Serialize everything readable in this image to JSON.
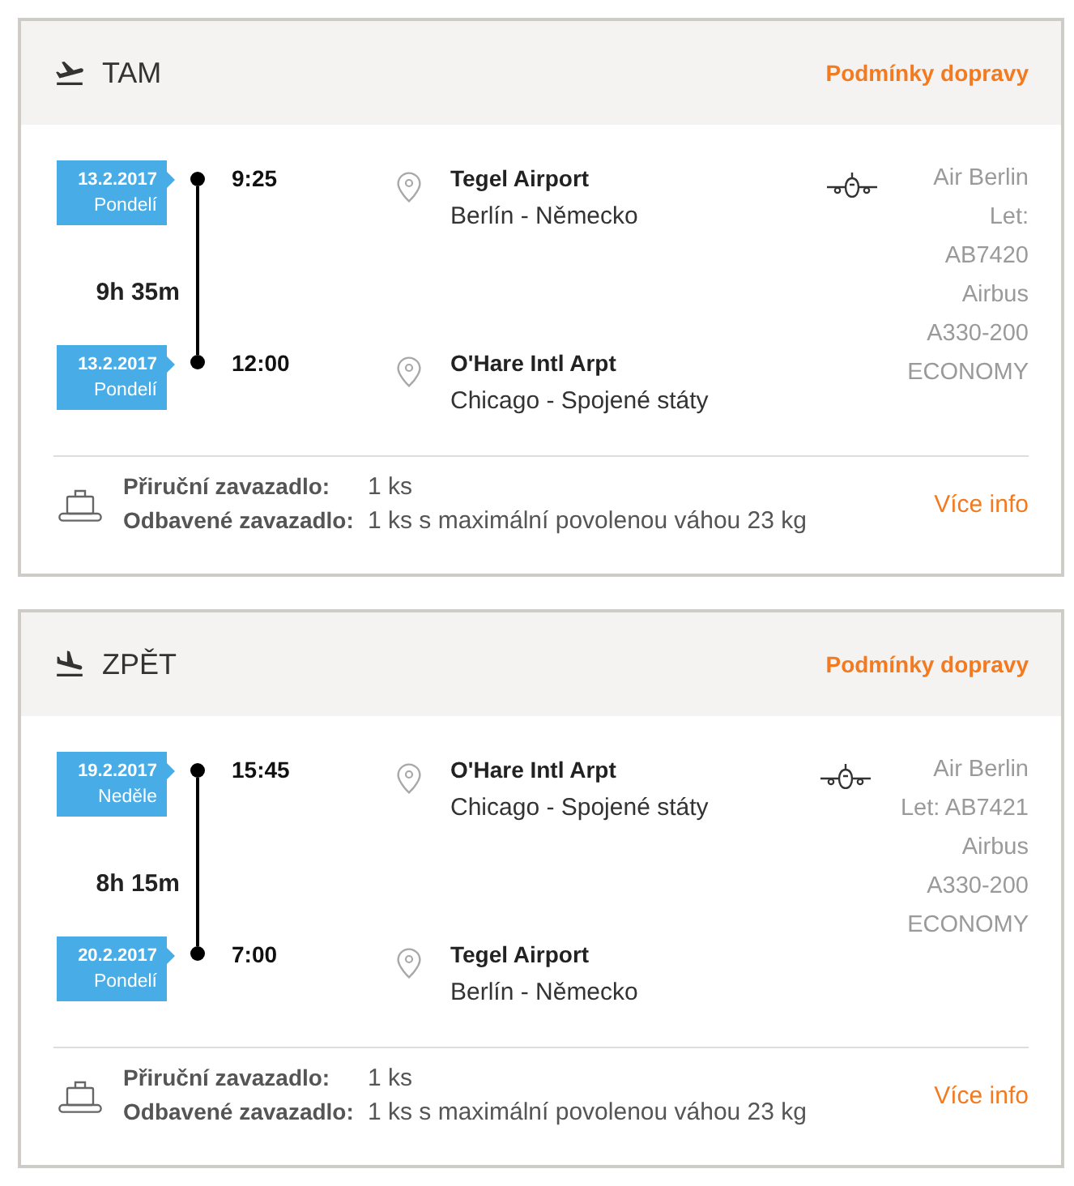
{
  "segments": [
    {
      "kind": "departure",
      "title": "TAM",
      "conditions_link": "Podmínky dopravy",
      "stops": [
        {
          "date": "13.2.2017",
          "day": "Pondelí",
          "time": "9:25",
          "airport": "Tegel Airport",
          "city": "Berlín - Německo"
        },
        {
          "date": "13.2.2017",
          "day": "Pondelí",
          "time": "12:00",
          "airport": "O'Hare Intl Arpt",
          "city": "Chicago - Spojené státy"
        }
      ],
      "duration": "9h 35m",
      "flight_info": [
        "Air Berlin",
        "Let:",
        "AB7420",
        "Airbus",
        "A330-200",
        "ECONOMY"
      ],
      "baggage": [
        {
          "label": "Přiruční zavazadlo:",
          "value": "1 ks"
        },
        {
          "label": "Odbavené zavazadlo:",
          "value": "1 ks s maximální povolenou váhou 23 kg"
        }
      ],
      "more_info": "Více info"
    },
    {
      "kind": "return",
      "title": "ZPĚT",
      "conditions_link": "Podmínky dopravy",
      "stops": [
        {
          "date": "19.2.2017",
          "day": "Neděle",
          "time": "15:45",
          "airport": "O'Hare Intl Arpt",
          "city": "Chicago - Spojené státy"
        },
        {
          "date": "20.2.2017",
          "day": "Pondelí",
          "time": "7:00",
          "airport": "Tegel Airport",
          "city": "Berlín - Německo"
        }
      ],
      "duration": "8h 15m",
      "flight_info": [
        "Air Berlin",
        "Let: AB7421",
        "Airbus",
        "A330-200",
        "ECONOMY"
      ],
      "baggage": [
        {
          "label": "Přiruční zavazadlo:",
          "value": "1 ks"
        },
        {
          "label": "Odbavené zavazadlo:",
          "value": "1 ks s maximální povolenou váhou 23 kg"
        }
      ],
      "more_info": "Více info"
    }
  ]
}
